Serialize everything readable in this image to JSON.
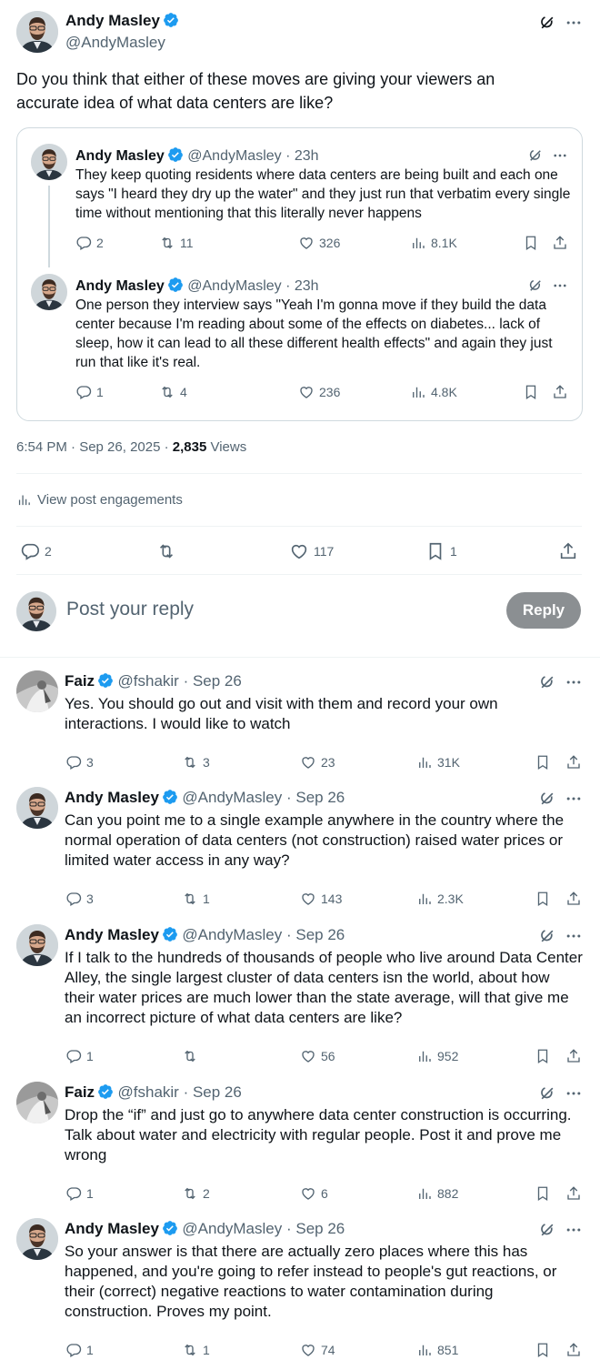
{
  "main_post": {
    "author": "Andy Masley",
    "handle": "@AndyMasley",
    "text": "Do you think that either of these moves are giving your viewers an accurate idea of what data centers are like?",
    "time": "6:54 PM · Sep 26, 2025 · ",
    "views_count": "2,835",
    "views_label": " Views",
    "engagements_label": "View post engagements",
    "stats": {
      "replies": "2",
      "reposts": "",
      "likes": "117",
      "bookmarks": "1"
    }
  },
  "quoted": [
    {
      "author": "Andy Masley",
      "handle": "@AndyMasley · 23h",
      "text": "They keep quoting residents where data centers are being built and each one says \"I heard they dry up the water\" and they just run that verbatim every single time without mentioning that this literally never happens",
      "replies": "2",
      "reposts": "11",
      "likes": "326",
      "views": "8.1K"
    },
    {
      "author": "Andy Masley",
      "handle": "@AndyMasley · 23h",
      "text": "One person they interview says \"Yeah I'm gonna move if they build the data center because I'm reading about some of the effects on diabetes... lack of sleep, how it can lead to all these different health effects\" and again they just run that like it's real.",
      "replies": "1",
      "reposts": "4",
      "likes": "236",
      "views": "4.8K"
    }
  ],
  "composer": {
    "placeholder": "Post your reply",
    "button": "Reply"
  },
  "replies": [
    {
      "author": "Faiz",
      "handle": "@fshakir · Sep 26",
      "text": "Yes. You should go out and visit with them and record your own interactions. I would like to watch",
      "replies": "3",
      "reposts": "3",
      "likes": "23",
      "views": "31K"
    },
    {
      "author": "Andy Masley",
      "handle": "@AndyMasley · Sep 26",
      "text": "Can you point me to a single example anywhere in the country where the normal operation of data centers (not  construction) raised water prices or limited water access in any way?",
      "replies": "3",
      "reposts": "1",
      "likes": "143",
      "views": "2.3K"
    },
    {
      "author": "Andy Masley",
      "handle": "@AndyMasley · Sep 26",
      "text": "If I talk to the hundreds of thousands of people who live around Data Center Alley, the single largest cluster of data centers isn the world, about how their water prices are much lower than the state average, will that give me an incorrect picture of what data centers are like?",
      "replies": "1",
      "reposts": "",
      "likes": "56",
      "views": "952"
    },
    {
      "author": "Faiz",
      "handle": "@fshakir · Sep 26",
      "text": "Drop the “if” and just go to anywhere data center construction is occurring. Talk about water and electricity with regular people. Post it and prove me wrong",
      "replies": "1",
      "reposts": "2",
      "likes": "6",
      "views": "882"
    },
    {
      "author": "Andy Masley",
      "handle": "@AndyMasley · Sep 26",
      "text": "So your answer is that there are actually zero places where this has happened, and you're going to refer instead to people's gut reactions, or their (correct) negative reactions to water contamination during construction. Proves my point.",
      "replies": "1",
      "reposts": "1",
      "likes": "74",
      "views": "851"
    }
  ],
  "colors": {
    "verified": "#1d9bf0",
    "muted": "#536471",
    "border": "#cfd9de",
    "reply_button": "#8b8f92"
  },
  "icons": [
    "verified-badge-icon",
    "grok-icon",
    "more-icon",
    "reply-icon",
    "repost-icon",
    "like-icon",
    "views-icon",
    "bookmark-icon",
    "share-icon"
  ]
}
